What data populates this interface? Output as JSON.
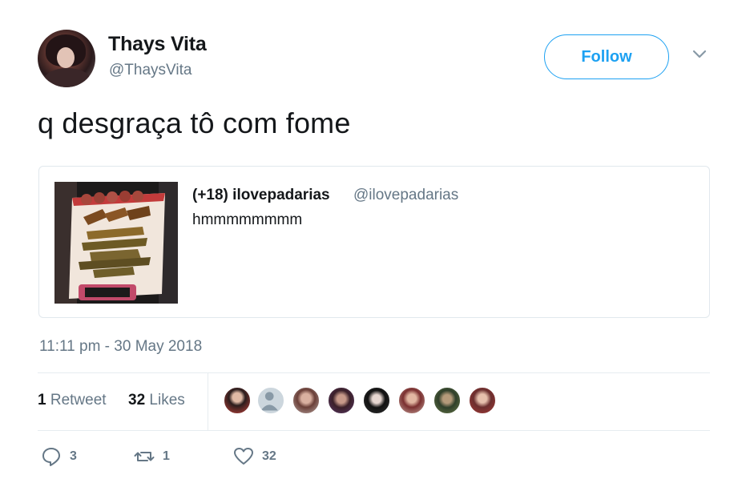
{
  "author": {
    "display_name": "Thays Vita",
    "handle": "@ThaysVita",
    "follow_label": "Follow"
  },
  "tweet": {
    "text": "q desgraça tô com fome",
    "timestamp": "11:11 pm - 30 May 2018"
  },
  "quoted_tweet": {
    "display_name": "(+18) ilovepadarias",
    "handle": "@ilovepadarias",
    "text": "hmmmmmmmm"
  },
  "stats": {
    "retweets_count": "1",
    "retweets_label": "Retweet",
    "likes_count": "32",
    "likes_label": "Likes"
  },
  "actions": {
    "reply_count": "3",
    "retweet_count": "1",
    "like_count": "32"
  },
  "colors": {
    "accent": "#1da1f2",
    "secondary_text": "#657786",
    "border": "#e6ecf0"
  }
}
